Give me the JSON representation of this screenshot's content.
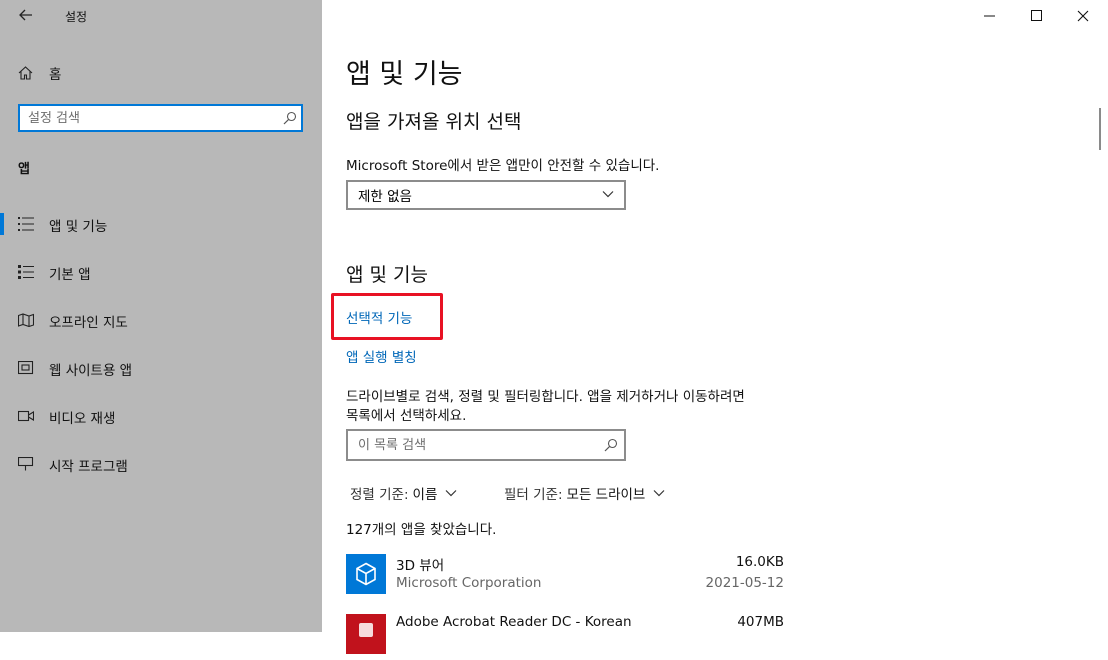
{
  "window": {
    "app_title": "설정"
  },
  "sidebar": {
    "home_label": "홈",
    "search_placeholder": "설정 검색",
    "section_title": "앱",
    "items": [
      {
        "label": "앱 및 기능",
        "icon": "apps-list-icon",
        "active": true
      },
      {
        "label": "기본 앱",
        "icon": "default-apps-icon"
      },
      {
        "label": "오프라인 지도",
        "icon": "map-icon"
      },
      {
        "label": "웹 사이트용 앱",
        "icon": "website-app-icon"
      },
      {
        "label": "비디오 재생",
        "icon": "video-icon"
      },
      {
        "label": "시작 프로그램",
        "icon": "startup-icon"
      }
    ]
  },
  "main": {
    "page_title": "앱 및 기능",
    "install_section": {
      "heading": "앱을 가져올 위치 선택",
      "description": "Microsoft Store에서 받은 앱만이 안전할 수 있습니다.",
      "dropdown_value": "제한 없음"
    },
    "apps_section": {
      "heading": "앱 및 기능",
      "optional_features_link": "선택적 기능",
      "aliases_link": "앱 실행 별칭",
      "description_line1": "드라이브별로 검색, 정렬 및 필터링합니다. 앱을 제거하거나 이동하려면",
      "description_line2": "목록에서 선택하세요.",
      "search_placeholder": "이 목록 검색",
      "sort_label": "정렬 기준:",
      "sort_value": "이름",
      "filter_label": "필터 기준:",
      "filter_value": "모든 드라이브",
      "count_text": "127개의 앱을 찾았습니다.",
      "apps": [
        {
          "name": "3D 뷰어",
          "publisher": "Microsoft Corporation",
          "size": "16.0KB",
          "date": "2021-05-12",
          "icon": "3d-viewer-icon",
          "icon_color": "#0078d7"
        },
        {
          "name": "Adobe Acrobat Reader DC - Korean",
          "publisher": "",
          "size": "407MB",
          "date": "",
          "icon": "acrobat-reader-icon",
          "icon_color": "#c1121c"
        }
      ]
    }
  },
  "colors": {
    "accent": "#0078d7",
    "link": "#0067b8",
    "highlight": "#e81123",
    "sidebar_bg": "#b8b8b8"
  }
}
